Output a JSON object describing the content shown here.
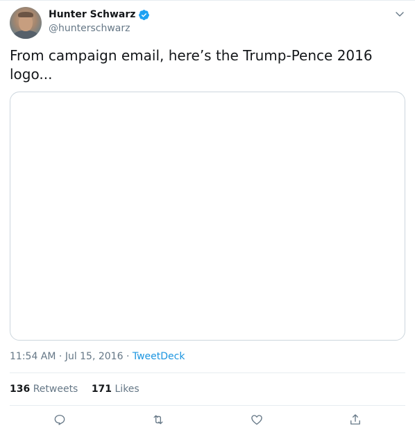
{
  "user": {
    "display_name": "Hunter Schwarz",
    "handle": "@hunterschwarz",
    "verified": true
  },
  "tweet": {
    "text": "From campaign email, here’s the Trump-Pence 2016 logo..."
  },
  "meta": {
    "time": "11:54 AM",
    "date": "Jul 15, 2016",
    "separator": "·",
    "source": "TweetDeck"
  },
  "stats": {
    "retweets_count": "136",
    "retweets_label": "Retweets",
    "likes_count": "171",
    "likes_label": "Likes"
  },
  "icons": {
    "verified": "verified-badge-icon",
    "menu": "chevron-down-icon",
    "reply": "reply-icon",
    "retweet": "retweet-icon",
    "like": "heart-icon",
    "share": "share-icon"
  },
  "colors": {
    "text": "#14171a",
    "secondary": "#657786",
    "link": "#1b95e0",
    "border": "#ccd6dd",
    "verified": "#1da1f2"
  }
}
